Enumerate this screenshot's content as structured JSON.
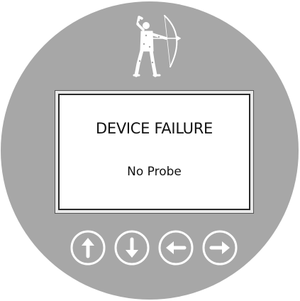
{
  "display": {
    "title": "DEVICE FAILURE",
    "message": "No Probe"
  },
  "buttons": [
    {
      "name": "up-button",
      "icon": "arrow-up-icon"
    },
    {
      "name": "down-button",
      "icon": "arrow-down-icon"
    },
    {
      "name": "left-button",
      "icon": "arrow-left-icon"
    },
    {
      "name": "right-button",
      "icon": "arrow-right-icon"
    }
  ],
  "colors": {
    "housing": "#a7a7a7",
    "screen_background": "#ffffff",
    "text": "#111111",
    "button_outline": "#ffffff"
  },
  "logo": {
    "icon": "archer-icon"
  }
}
